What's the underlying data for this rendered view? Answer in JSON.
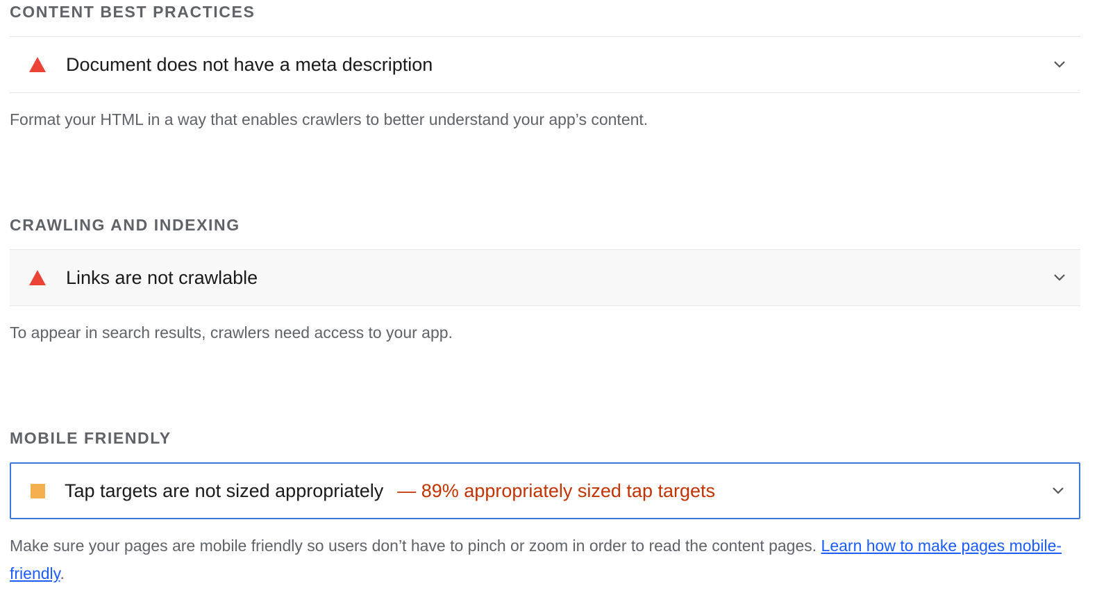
{
  "groups": [
    {
      "title": "CONTENT BEST PRACTICES",
      "audit": {
        "status": "fail",
        "title": "Document does not have a meta description",
        "display_value": ""
      },
      "description": "Format your HTML in a way that enables crawlers to better understand your app’s content."
    },
    {
      "title": "CRAWLING AND INDEXING",
      "audit": {
        "status": "fail",
        "title": "Links are not crawlable",
        "display_value": ""
      },
      "description": "To appear in search results, crawlers need access to your app."
    },
    {
      "title": "MOBILE FRIENDLY",
      "audit": {
        "status": "average",
        "title": "Tap targets are not sized appropriately",
        "display_value": "— 89% appropriately sized tap targets"
      },
      "description": "Make sure your pages are mobile friendly so users don’t have to pinch or zoom in order to read the content pages.",
      "link_text": "Learn how to make pages mobile-friendly",
      "trailing": "."
    }
  ],
  "icons": {
    "fail": "red-triangle-icon",
    "average": "orange-square-icon",
    "expand": "chevron-down-icon"
  },
  "colors": {
    "fail": "#eb4335",
    "average": "#f4b04f",
    "display_value": "#c33300",
    "link": "#1a5cff",
    "focus_border": "#3c78d8"
  }
}
